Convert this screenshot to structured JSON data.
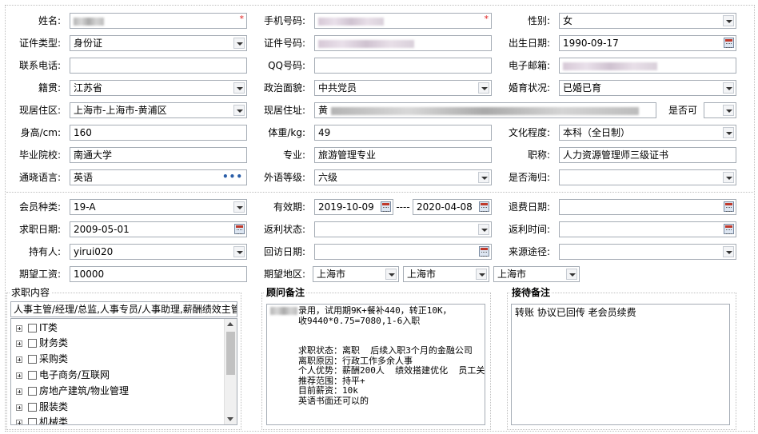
{
  "personal": {
    "name_label": "姓名:",
    "phone_label": "手机号码:",
    "gender_label": "性别:",
    "gender_value": "女",
    "id_type_label": "证件类型:",
    "id_type_value": "身份证",
    "id_number_label": "证件号码:",
    "birth_label": "出生日期:",
    "birth_value": "1990-09-17",
    "contact_label": "联系电话:",
    "qq_label": "QQ号码:",
    "email_label": "电子邮箱:",
    "native_label": "籍贯:",
    "native_value": "江苏省",
    "political_label": "政治面貌:",
    "political_value": "中共党员",
    "marital_label": "婚育状况:",
    "marital_value": "已婚已育",
    "residence_label": "现居住区:",
    "residence_value": "上海市-上海市-黄浦区",
    "address_label": "现居住址:",
    "address_prefix": "黄",
    "whether_label": "是否可",
    "height_label": "身高/cm:",
    "height_value": "160",
    "weight_label": "体重/kg:",
    "weight_value": "49",
    "education_label": "文化程度:",
    "education_value": "本科（全日制）",
    "school_label": "毕业院校:",
    "school_value": "南通大学",
    "major_label": "专业:",
    "major_value": "旅游管理专业",
    "title_label": "职称:",
    "title_value": "人力资源管理师三级证书",
    "language_label": "通晓语言:",
    "language_value": "英语",
    "language_more": "•••",
    "level_label": "外语等级:",
    "level_value": "六级",
    "overseas_label": "是否海归:"
  },
  "membership": {
    "member_type_label": "会员种类:",
    "member_type_value": "19-A",
    "validity_label": "有效期:",
    "valid_from": "2019-10-09",
    "valid_sep": "----",
    "valid_to": "2020-04-08",
    "refund_label": "退费日期:",
    "jobdate_label": "求职日期:",
    "jobdate_value": "2009-05-01",
    "rebate_status_label": "返利状态:",
    "rebate_time_label": "返利时间:",
    "holder_label": "持有人:",
    "holder_value": "yirui020",
    "visit_label": "回访日期:",
    "source_label": "来源途径:",
    "salary_label": "期望工资:",
    "salary_value": "10000",
    "region_label": "期望地区:",
    "region_1": "上海市",
    "region_2": "上海市",
    "region_3": "上海市"
  },
  "job_content": {
    "title": "求职内容",
    "summary": "人事主管/经理/总监,人事专员/人事助理,薪酬绩效主管",
    "tree": [
      "IT类",
      "财务类",
      "采购类",
      "电子商务/互联网",
      "房地产建筑/物业管理",
      "服装类",
      "机械类"
    ]
  },
  "advisor_notes": {
    "title": "顾问备注",
    "text": "录用，试用期9K+餐补440，转正10K，\n收9440*0.75=7080,1-6入职\n\n\n求职状态：离职  后续入职3个月的金融公司\n离职原因：行政工作多余人事\n个人优势：薪酬200人  绩效搭建优化  员工关系\n推荐范围：持平+\n目前薪资：10k\n英语书面还可以的"
  },
  "reception_notes": {
    "title": "接待备注",
    "text": "转账 协议已回传 老会员续费"
  },
  "marks": {
    "required": "*"
  }
}
